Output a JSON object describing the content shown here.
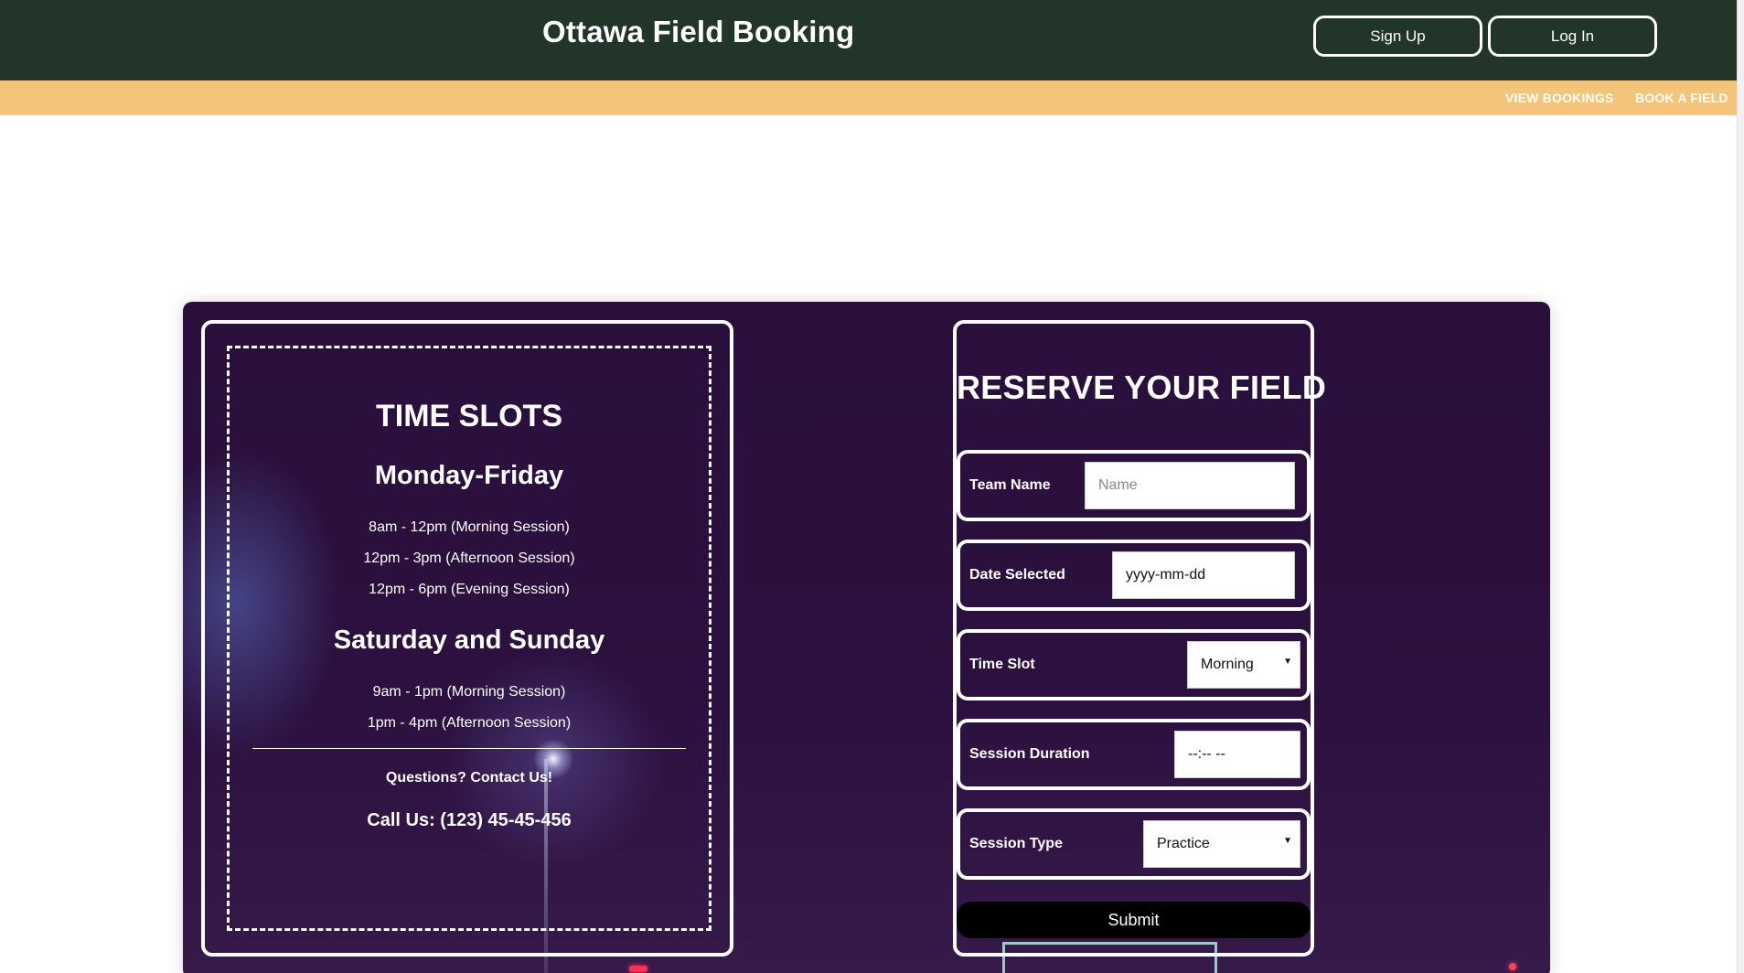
{
  "header": {
    "title": "Ottawa Field Booking",
    "signup_label": "Sign Up",
    "login_label": "Log In"
  },
  "nav": {
    "view_bookings": "VIEW BOOKINGS",
    "book_field": "BOOK A FIELD"
  },
  "timeslots": {
    "title": "TIME SLOTS",
    "weekday_heading": "Monday-Friday",
    "weekday_slots": [
      "8am - 12pm (Morning Session)",
      "12pm - 3pm (Afternoon Session)",
      "12pm - 6pm (Evening Session)"
    ],
    "weekend_heading": "Saturday and Sunday",
    "weekend_slots": [
      "9am - 1pm (Morning Session)",
      "1pm - 4pm (Afternoon Session)"
    ],
    "questions": "Questions? Contact Us!",
    "phone": "Call Us: (123) 45-45-456"
  },
  "form": {
    "title": "RESERVE YOUR FIELD",
    "team_name_label": "Team Name",
    "team_name_placeholder": "Name",
    "date_label": "Date Selected",
    "date_value": "yyyy-mm-dd",
    "time_slot_label": "Time Slot",
    "time_slot_value": "Morning",
    "duration_label": "Session Duration",
    "duration_value": "--:-- --",
    "session_type_label": "Session Type",
    "session_type_value": "Practice",
    "submit_label": "Submit"
  },
  "colors": {
    "header_bg": "#213629",
    "nav_bg": "#f3c47a",
    "panel_bg": "#2a0f3b",
    "submit_bg": "#000000"
  }
}
